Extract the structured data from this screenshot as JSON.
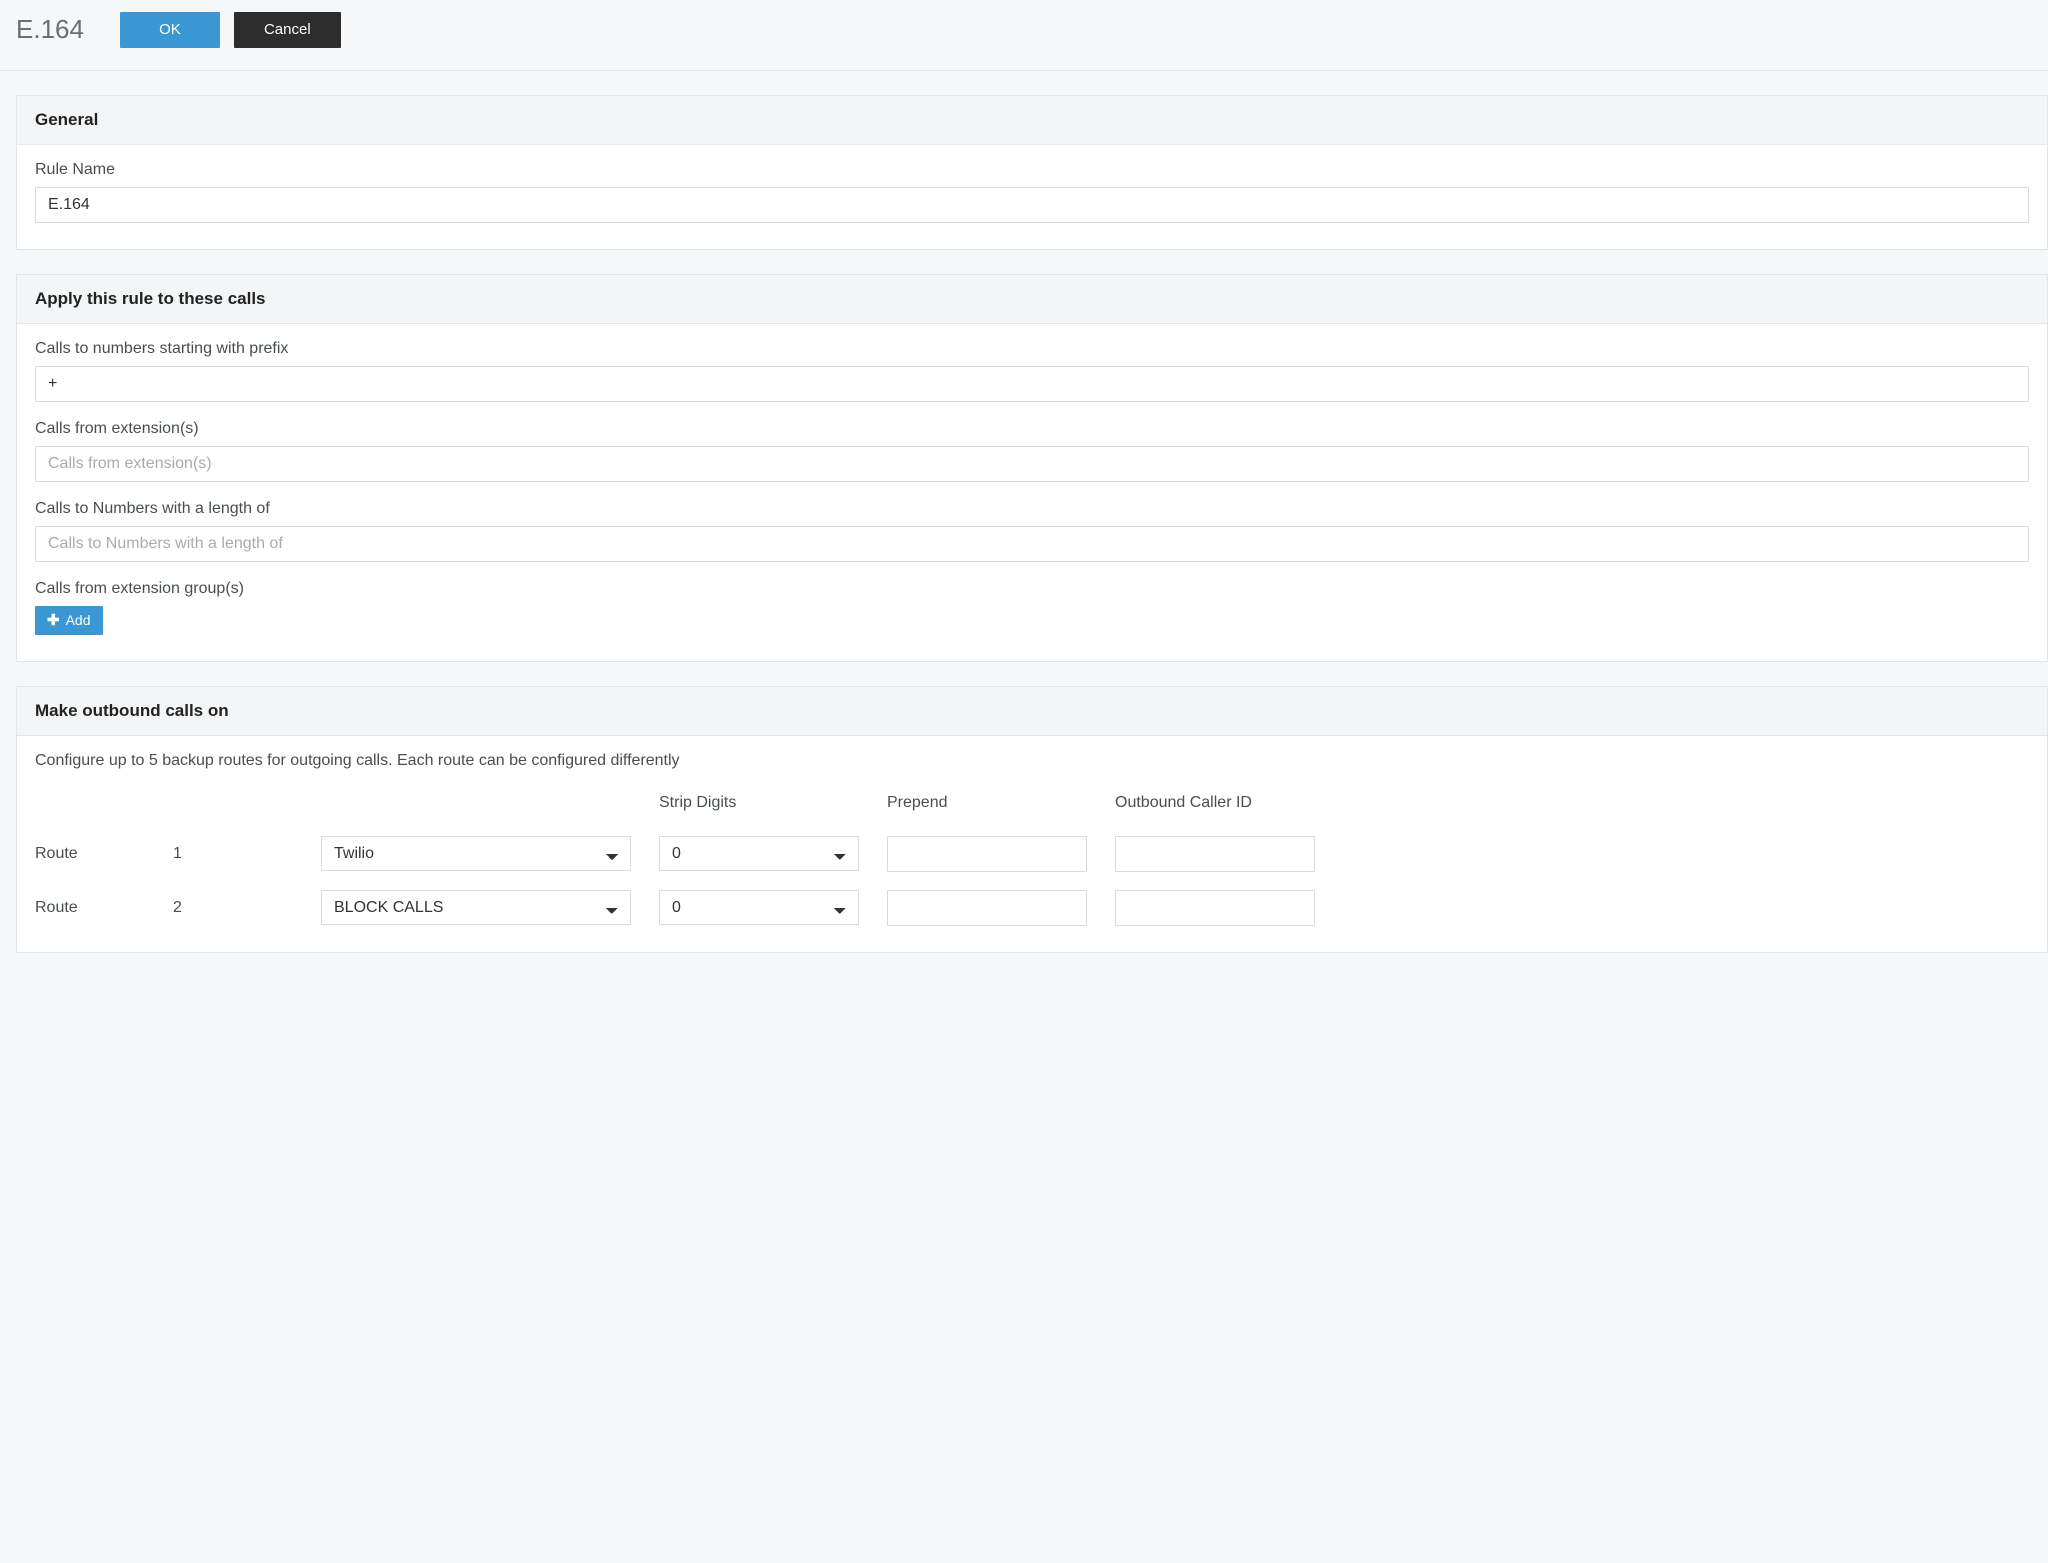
{
  "header": {
    "title": "E.164",
    "ok_label": "OK",
    "cancel_label": "Cancel"
  },
  "panels": {
    "general": {
      "title": "General",
      "rule_name_label": "Rule Name",
      "rule_name_value": "E.164"
    },
    "apply": {
      "title": "Apply this rule to these calls",
      "prefix_label": "Calls to numbers starting with prefix",
      "prefix_value": "+",
      "from_ext_label": "Calls from extension(s)",
      "from_ext_placeholder": "Calls from extension(s)",
      "from_ext_value": "",
      "length_label": "Calls to Numbers with a length of",
      "length_placeholder": "Calls to Numbers with a length of",
      "length_value": "",
      "group_label": "Calls from extension group(s)",
      "add_label": "Add"
    },
    "outbound": {
      "title": "Make outbound calls on",
      "help": "Configure up to 5 backup routes for outgoing calls. Each route can be configured differently",
      "columns": {
        "strip": "Strip Digits",
        "prepend": "Prepend",
        "caller_id": "Outbound Caller ID"
      },
      "route_label": "Route",
      "routes": [
        {
          "index": "1",
          "provider_selected": "Twilio",
          "strip_selected": "0",
          "prepend": "",
          "caller_id": ""
        },
        {
          "index": "2",
          "provider_selected": "BLOCK CALLS",
          "strip_selected": "0",
          "prepend": "",
          "caller_id": ""
        }
      ],
      "provider_options": [
        "Twilio",
        "BLOCK CALLS"
      ],
      "strip_options": [
        "0"
      ]
    }
  }
}
